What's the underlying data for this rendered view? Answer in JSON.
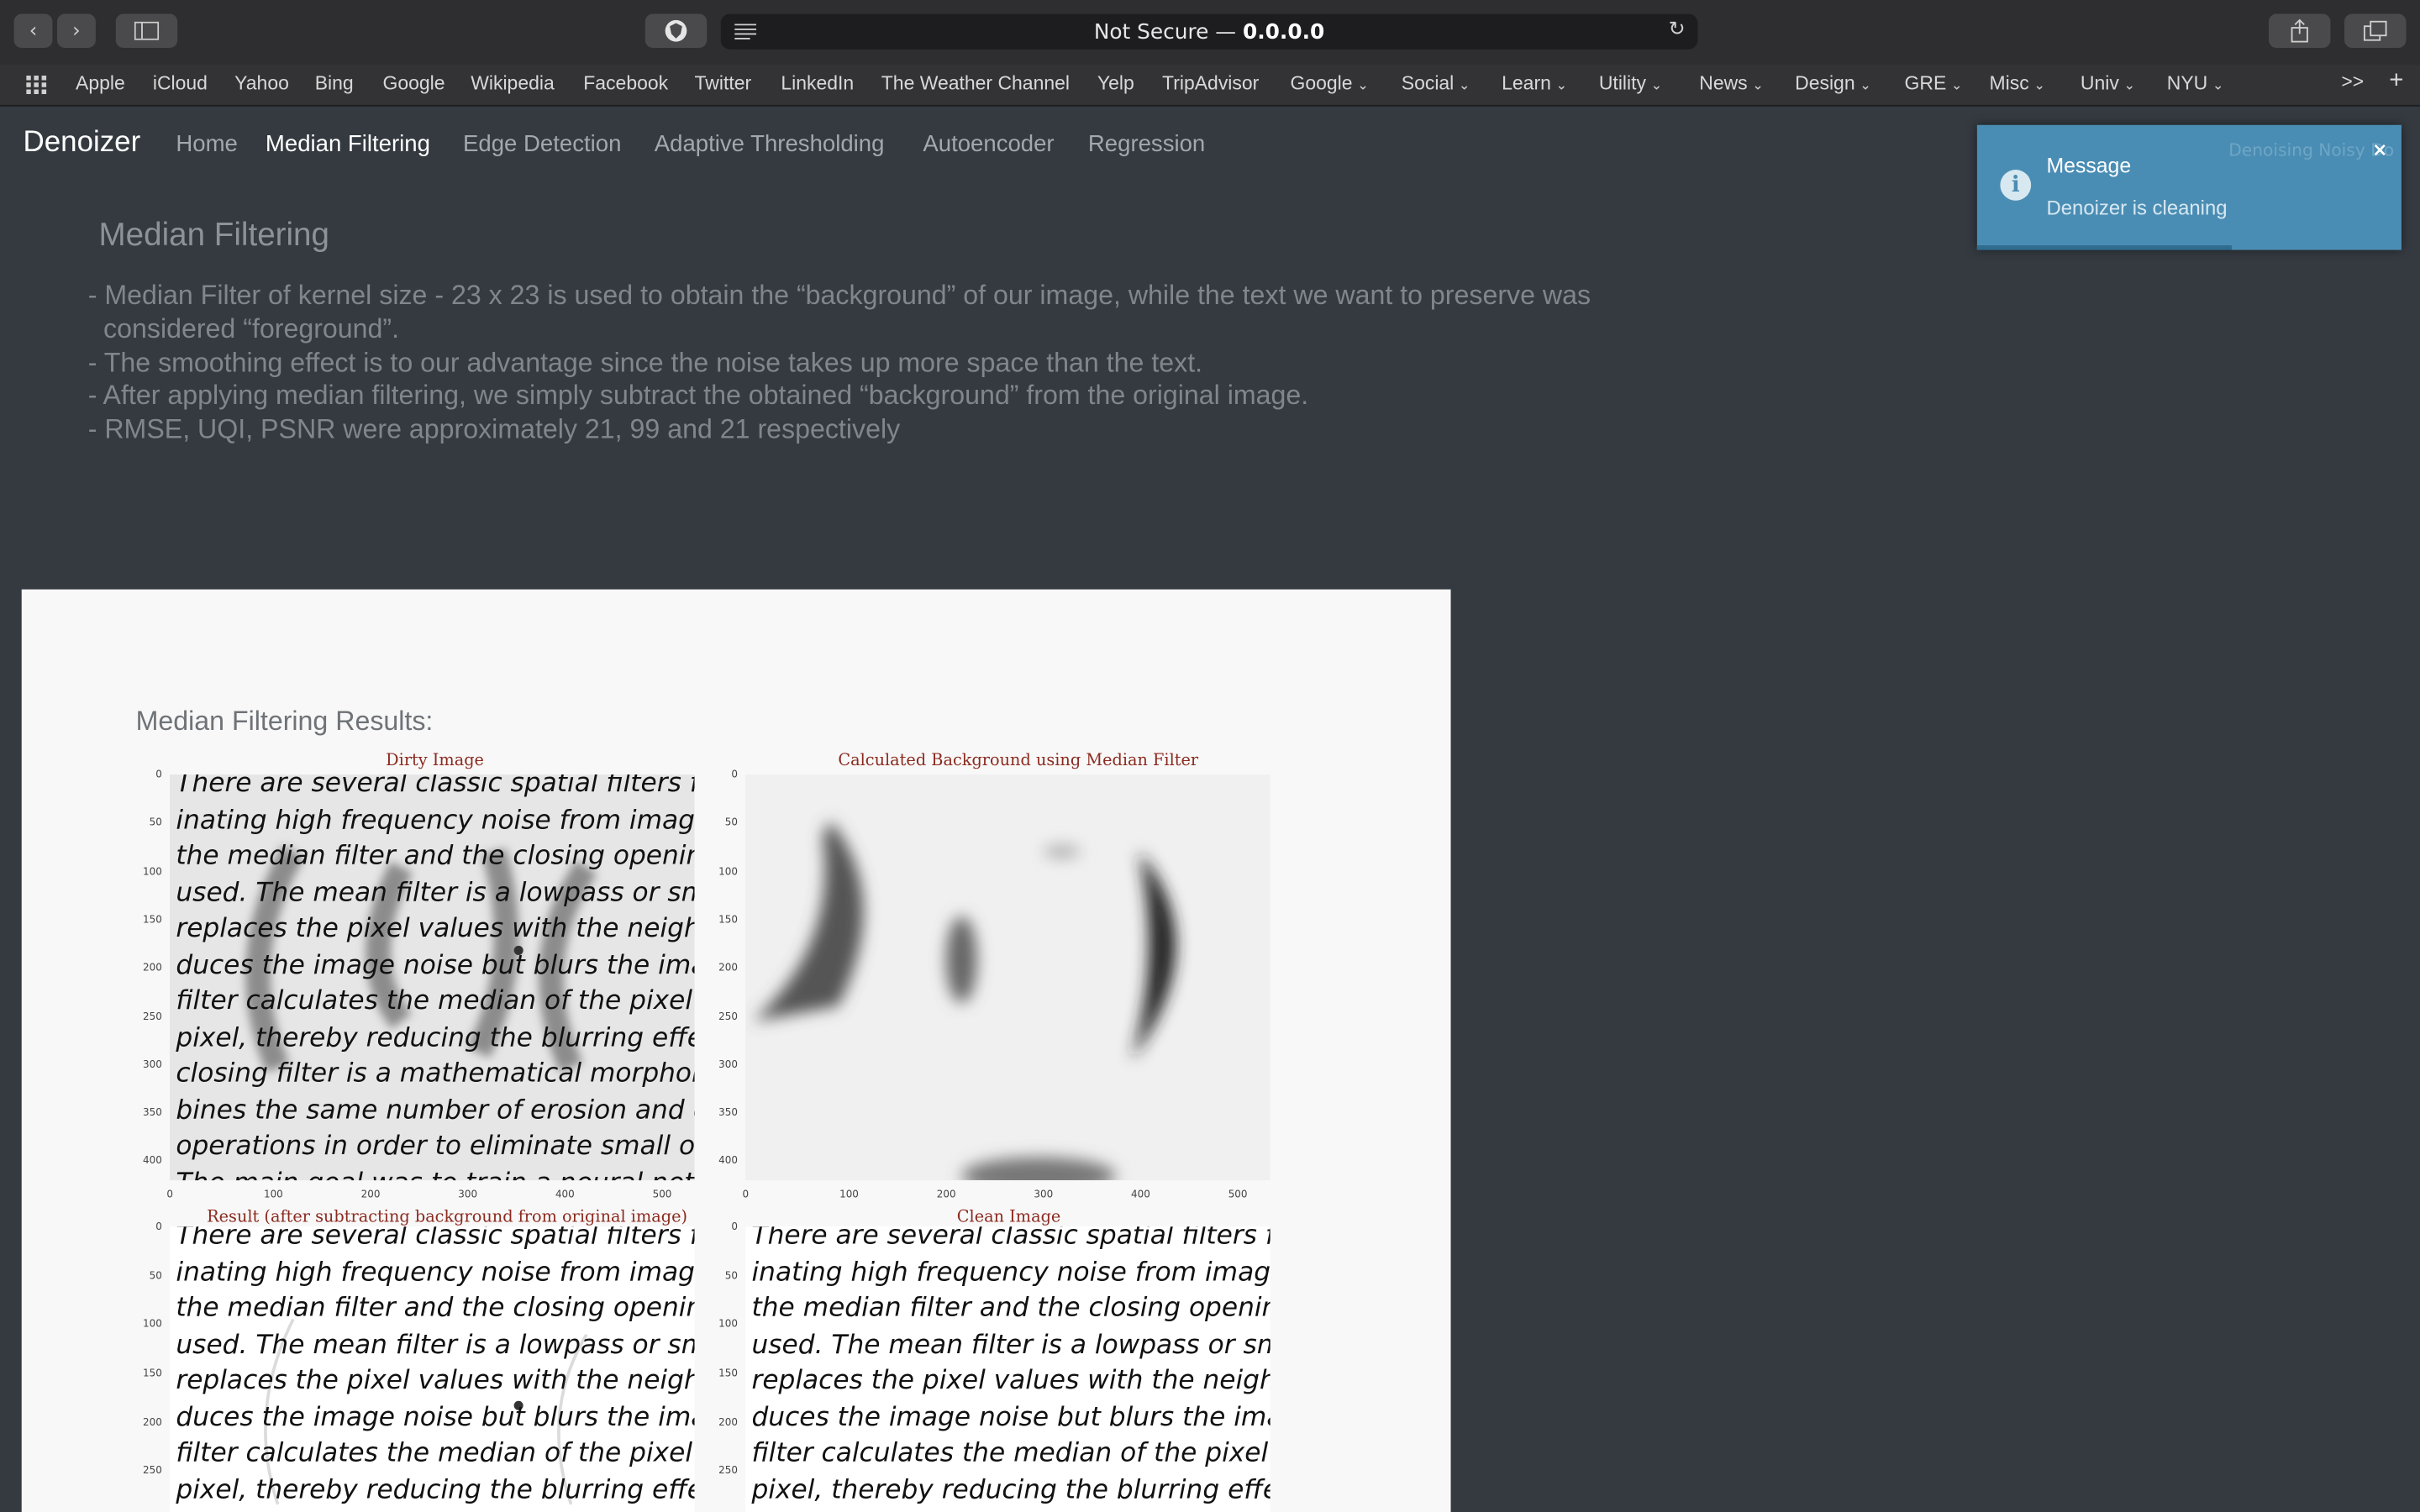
{
  "browser": {
    "nav_back": "‹",
    "nav_forward": "›",
    "url_prefix": "Not Secure — ",
    "url_host": "0.0.0.0",
    "bookmarks": [
      {
        "label": "Apple",
        "dropdown": false
      },
      {
        "label": "iCloud",
        "dropdown": false
      },
      {
        "label": "Yahoo",
        "dropdown": false
      },
      {
        "label": "Bing",
        "dropdown": false
      },
      {
        "label": "Google",
        "dropdown": false
      },
      {
        "label": "Wikipedia",
        "dropdown": false
      },
      {
        "label": "Facebook",
        "dropdown": false
      },
      {
        "label": "Twitter",
        "dropdown": false
      },
      {
        "label": "LinkedIn",
        "dropdown": false
      },
      {
        "label": "The Weather Channel",
        "dropdown": false
      },
      {
        "label": "Yelp",
        "dropdown": false
      },
      {
        "label": "TripAdvisor",
        "dropdown": false
      },
      {
        "label": "Google",
        "dropdown": true
      },
      {
        "label": "Social",
        "dropdown": true
      },
      {
        "label": "Learn",
        "dropdown": true
      },
      {
        "label": "Utility",
        "dropdown": true
      },
      {
        "label": "News",
        "dropdown": true
      },
      {
        "label": "Design",
        "dropdown": true
      },
      {
        "label": "GRE",
        "dropdown": true
      },
      {
        "label": "Misc",
        "dropdown": true
      },
      {
        "label": "Univ",
        "dropdown": true
      },
      {
        "label": "NYU",
        "dropdown": true
      }
    ],
    "overflow": ">>",
    "new_tab": "+"
  },
  "navbar": {
    "brand": "Denoizer",
    "links": [
      {
        "label": "Home",
        "active": false
      },
      {
        "label": "Median Filtering",
        "active": true
      },
      {
        "label": "Edge Detection",
        "active": false
      },
      {
        "label": "Adaptive Thresholding",
        "active": false
      },
      {
        "label": "Autoencoder",
        "active": false
      },
      {
        "label": "Regression",
        "active": false
      }
    ]
  },
  "toast": {
    "title": "Message",
    "message": "Denoizer is cleaning",
    "ghost_text": "Denoising Noisy Do",
    "close": "×",
    "progress": 0.6
  },
  "main": {
    "heading": "Median Filtering",
    "bullets": [
      "- Median Filter of kernel size - 23 x 23 is used to obtain the “background” of our image, while the text we want to preserve was considered “foreground”.",
      "- The smoothing effect is to our advantage since the noise takes up more space than the text.",
      "- After applying median filtering, we simply subtract the obtained “background” from the original image.",
      "- RMSE, UQI, PSNR were approximately 21, 99 and 21 respectively"
    ]
  },
  "results": {
    "title": "Median Filtering Results:",
    "plots": [
      {
        "title": "Dirty Image",
        "yticks": [
          "0",
          "50",
          "100",
          "150",
          "200",
          "250",
          "300",
          "350",
          "400"
        ],
        "xticks": [
          "0",
          "100",
          "200",
          "300",
          "400",
          "500"
        ]
      },
      {
        "title": "Calculated Background using Median Filter",
        "yticks": [
          "0",
          "50",
          "100",
          "150",
          "200",
          "250",
          "300",
          "350",
          "400"
        ],
        "xticks": [
          "0",
          "100",
          "200",
          "300",
          "400",
          "500"
        ]
      },
      {
        "title": "Result (after subtracting background from original image)",
        "yticks": [
          "0",
          "50",
          "100",
          "150",
          "200",
          "250"
        ],
        "xticks": []
      },
      {
        "title": "Clean Image",
        "yticks": [
          "0",
          "50",
          "100",
          "150",
          "200",
          "250"
        ],
        "xticks": []
      }
    ],
    "document_lines": [
      "   There are several classic spatial filters for",
      "inating high frequency noise from images.",
      "the median filter and the closing opening fi",
      "used.  The mean filter is a lowpass or smo",
      "replaces the pixel values with the neighborh",
      "duces the image noise but blurs the image e",
      "filter calculates the median of the pixel neig",
      "pixel, thereby reducing the blurring effect. F",
      "closing filter is a mathematical morphologic",
      "bines the same number of erosion and dilat",
      "operations in order to eliminate small objec",
      "   The main goal was to train a neural net"
    ]
  }
}
